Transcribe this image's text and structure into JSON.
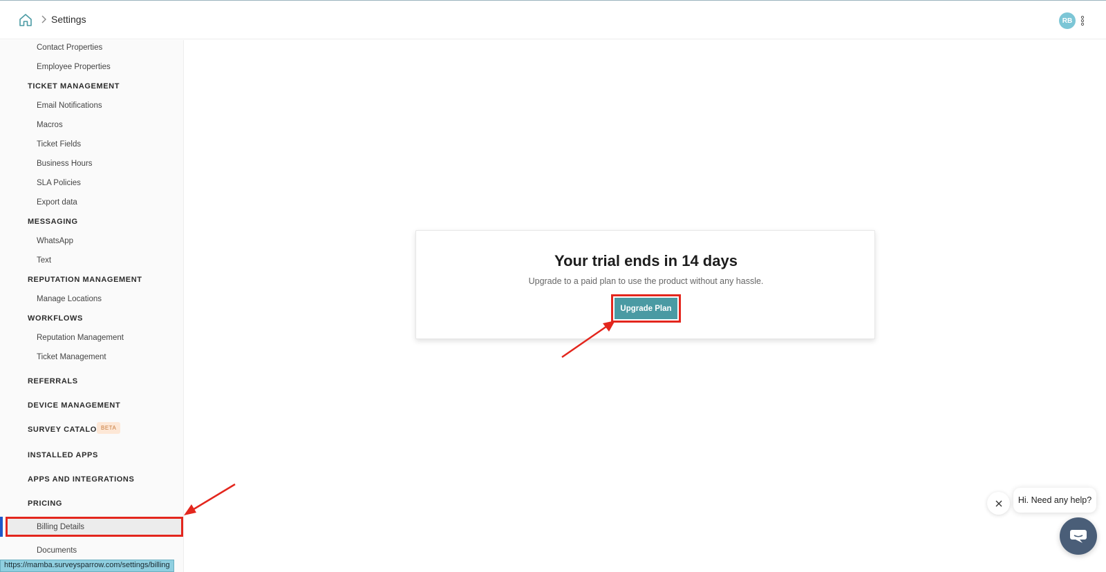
{
  "header": {
    "breadcrumb_title": "Settings",
    "avatar_initials": "RB"
  },
  "sidebar": {
    "items": [
      {
        "label": "Contact Properties",
        "type": "item"
      },
      {
        "label": "Employee Properties",
        "type": "item"
      },
      {
        "label": "TICKET MANAGEMENT",
        "type": "heading"
      },
      {
        "label": "Email Notifications",
        "type": "item"
      },
      {
        "label": "Macros",
        "type": "item"
      },
      {
        "label": "Ticket Fields",
        "type": "item"
      },
      {
        "label": "Business Hours",
        "type": "item"
      },
      {
        "label": "SLA Policies",
        "type": "item"
      },
      {
        "label": "Export data",
        "type": "item"
      },
      {
        "label": "MESSAGING",
        "type": "heading"
      },
      {
        "label": "WhatsApp",
        "type": "item"
      },
      {
        "label": "Text",
        "type": "item"
      },
      {
        "label": "REPUTATION MANAGEMENT",
        "type": "heading"
      },
      {
        "label": "Manage Locations",
        "type": "item"
      },
      {
        "label": "WORKFLOWS",
        "type": "heading"
      },
      {
        "label": "Reputation Management",
        "type": "item"
      },
      {
        "label": "Ticket Management",
        "type": "item"
      },
      {
        "label": "REFERRALS",
        "type": "heading"
      },
      {
        "label": "DEVICE MANAGEMENT",
        "type": "heading"
      },
      {
        "label": "SURVEY CATALOG",
        "type": "heading",
        "badge": "BETA"
      },
      {
        "label": "INSTALLED APPS",
        "type": "heading"
      },
      {
        "label": "APPS AND INTEGRATIONS",
        "type": "heading"
      },
      {
        "label": "PRICING",
        "type": "heading"
      },
      {
        "label": "Billing Details",
        "type": "item",
        "active": true
      },
      {
        "label": "Documents",
        "type": "item"
      }
    ]
  },
  "trial": {
    "title": "Your trial ends in 14 days",
    "subtitle": "Upgrade to a paid plan to use the product without any hassle.",
    "button_label": "Upgrade Plan"
  },
  "chat": {
    "bubble_text": "Hi. Need any help?"
  },
  "status_bar": {
    "url": "https://mamba.surveysparrow.com/settings/billing"
  },
  "colors": {
    "accent": "#4a9aa3",
    "highlight": "#e3261d",
    "active_marker": "#1f57c9",
    "chat_launcher": "#4a5e78",
    "avatar": "#7cc6d6"
  }
}
